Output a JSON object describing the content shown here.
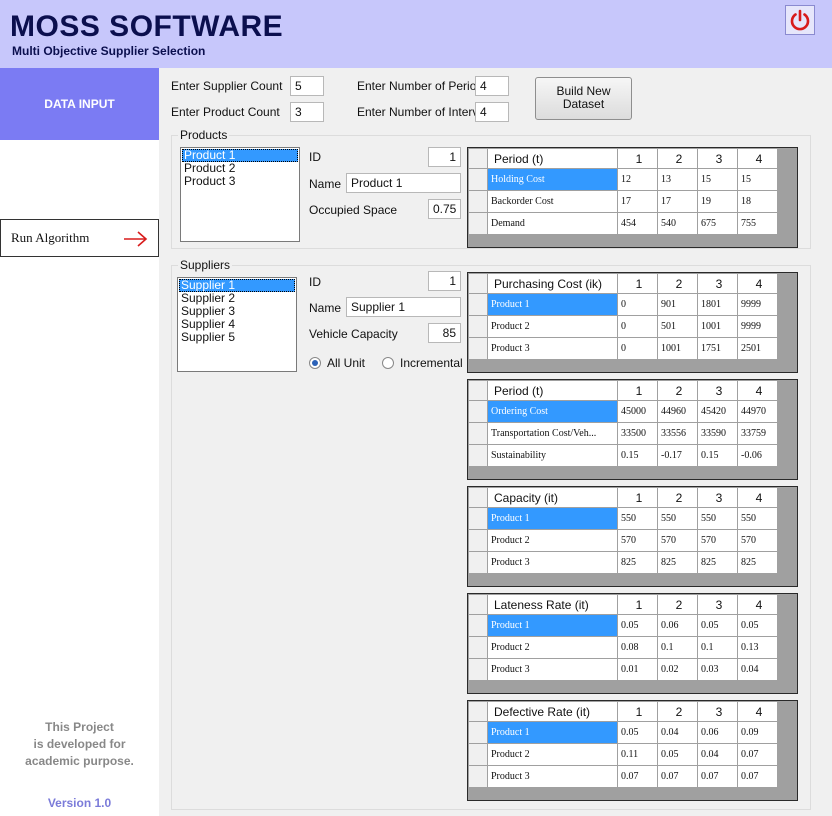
{
  "header": {
    "title": "MOSS SOFTWARE",
    "subtitle": "Multi Objective Supplier Selection"
  },
  "sidebar": {
    "data_input": "DATA INPUT",
    "run_algorithm": "Run Algorithm",
    "note_line1": "This Project",
    "note_line2": "is developed for",
    "note_line3": "academic purpose.",
    "version": "Version 1.0"
  },
  "top": {
    "supplier_count_label": "Enter Supplier Count",
    "supplier_count": "5",
    "product_count_label": "Enter Product Count",
    "product_count": "3",
    "period_label": "Enter Number of Period",
    "period": "4",
    "interval_label": "Enter Number of Interval",
    "interval": "4",
    "build_line1": "Build New",
    "build_line2": "Dataset"
  },
  "products": {
    "title": "Products",
    "list": [
      "Product 1",
      "Product 2",
      "Product 3"
    ],
    "id_label": "ID",
    "id": "1",
    "name_label": "Name",
    "name": "Product 1",
    "space_label": "Occupied Space",
    "space": "0.75",
    "grid": {
      "header": "Period (t)",
      "cols": [
        "1",
        "2",
        "3",
        "4"
      ],
      "rows": [
        {
          "label": "Holding Cost",
          "values": [
            "12",
            "13",
            "15",
            "15"
          ]
        },
        {
          "label": "Backorder Cost",
          "values": [
            "17",
            "17",
            "19",
            "18"
          ]
        },
        {
          "label": "Demand",
          "values": [
            "454",
            "540",
            "675",
            "755"
          ]
        }
      ]
    }
  },
  "suppliers": {
    "title": "Suppliers",
    "list": [
      "Supplier 1",
      "Supplier 2",
      "Supplier 3",
      "Supplier 4",
      "Supplier 5"
    ],
    "id_label": "ID",
    "id": "1",
    "name_label": "Name",
    "name": "Supplier 1",
    "vehicle_label": "Vehicle Capacity",
    "vehicle": "85",
    "radio_all": "All Unit",
    "radio_inc": "Incremental",
    "grids": [
      {
        "header": "Purchasing Cost (ik)",
        "cols": [
          "1",
          "2",
          "3",
          "4"
        ],
        "rows": [
          {
            "label": "Product 1",
            "values": [
              "0",
              "901",
              "1801",
              "9999"
            ]
          },
          {
            "label": "Product 2",
            "values": [
              "0",
              "501",
              "1001",
              "9999"
            ]
          },
          {
            "label": "Product 3",
            "values": [
              "0",
              "1001",
              "1751",
              "2501"
            ]
          }
        ]
      },
      {
        "header": "Period (t)",
        "cols": [
          "1",
          "2",
          "3",
          "4"
        ],
        "rows": [
          {
            "label": "Ordering Cost",
            "values": [
              "45000",
              "44960",
              "45420",
              "44970"
            ]
          },
          {
            "label": "Transportation Cost/Veh...",
            "values": [
              "33500",
              "33556",
              "33590",
              "33759"
            ]
          },
          {
            "label": "Sustainability",
            "values": [
              "0.15",
              "-0.17",
              "0.15",
              "-0.06"
            ]
          }
        ]
      },
      {
        "header": "Capacity (it)",
        "cols": [
          "1",
          "2",
          "3",
          "4"
        ],
        "rows": [
          {
            "label": "Product 1",
            "values": [
              "550",
              "550",
              "550",
              "550"
            ]
          },
          {
            "label": "Product 2",
            "values": [
              "570",
              "570",
              "570",
              "570"
            ]
          },
          {
            "label": "Product 3",
            "values": [
              "825",
              "825",
              "825",
              "825"
            ]
          }
        ]
      },
      {
        "header": "Lateness Rate (it)",
        "cols": [
          "1",
          "2",
          "3",
          "4"
        ],
        "rows": [
          {
            "label": "Product 1",
            "values": [
              "0.05",
              "0.06",
              "0.05",
              "0.05"
            ]
          },
          {
            "label": "Product 2",
            "values": [
              "0.08",
              "0.1",
              "0.1",
              "0.13"
            ]
          },
          {
            "label": "Product 3",
            "values": [
              "0.01",
              "0.02",
              "0.03",
              "0.04"
            ]
          }
        ]
      },
      {
        "header": "Defective Rate (it)",
        "cols": [
          "1",
          "2",
          "3",
          "4"
        ],
        "rows": [
          {
            "label": "Product 1",
            "values": [
              "0.05",
              "0.04",
              "0.06",
              "0.09"
            ]
          },
          {
            "label": "Product 2",
            "values": [
              "0.11",
              "0.05",
              "0.04",
              "0.07"
            ]
          },
          {
            "label": "Product 3",
            "values": [
              "0.07",
              "0.07",
              "0.07",
              "0.07"
            ]
          }
        ]
      }
    ]
  },
  "colors": {
    "header_bg": "#c7c7fb",
    "brand": "#0b0f4e",
    "sidebar_active": "#7b7bf3",
    "selection": "#3399ff",
    "power": "#d81b1b"
  },
  "icons": {
    "power": "power-icon",
    "arrow": "arrow-right-icon"
  }
}
